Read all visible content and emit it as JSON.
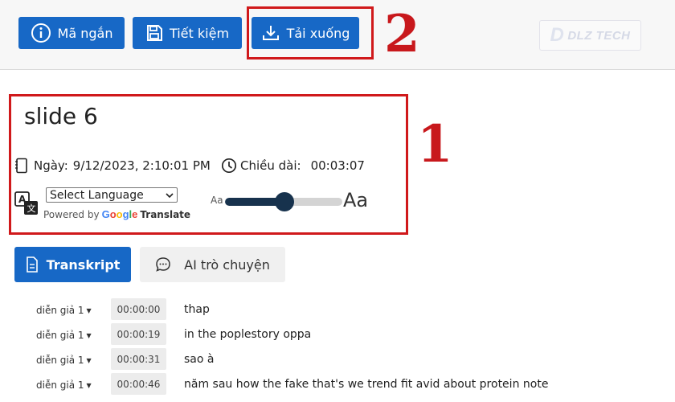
{
  "toolbar": {
    "buttons": [
      {
        "label": "Mã ngắn",
        "icon": "info-icon"
      },
      {
        "label": "Tiết kiệm",
        "icon": "save-icon"
      },
      {
        "label": "Tải xuống",
        "icon": "download-icon"
      }
    ],
    "logo_text": "DLZ TECH"
  },
  "annotations": {
    "box1": "1",
    "box2": "2",
    "color": "#d0191b"
  },
  "recording": {
    "title": "slide 6",
    "date_label": "Ngày:",
    "date_value": "9/12/2023, 2:10:01 PM",
    "duration_label": "Chiều dài:",
    "duration_value": "00:03:07"
  },
  "translate": {
    "select_value": "Select Language",
    "powered_by": "Powered by",
    "google": "Google",
    "translate_word": "Translate"
  },
  "font_size": {
    "small_label": "Aa",
    "large_label": "Aa",
    "level_fraction": 0.5
  },
  "tabs": [
    {
      "label": "Transkript",
      "active": true
    },
    {
      "label": "AI trò chuyện",
      "active": false
    }
  ],
  "transcript": [
    {
      "speaker": "diễn giả 1",
      "time": "00:00:00",
      "text": "thap"
    },
    {
      "speaker": "diễn giả 1",
      "time": "00:00:19",
      "text": "in the poplestory oppa"
    },
    {
      "speaker": "diễn giả 1",
      "time": "00:00:31",
      "text": "sao à"
    },
    {
      "speaker": "diễn giả 1",
      "time": "00:00:46",
      "text": "năm sau how the fake that's we trend fit avid about protein note"
    }
  ],
  "colors": {
    "accent": "#1768c6",
    "slider": "#17324d",
    "annotation": "#d0191b"
  }
}
